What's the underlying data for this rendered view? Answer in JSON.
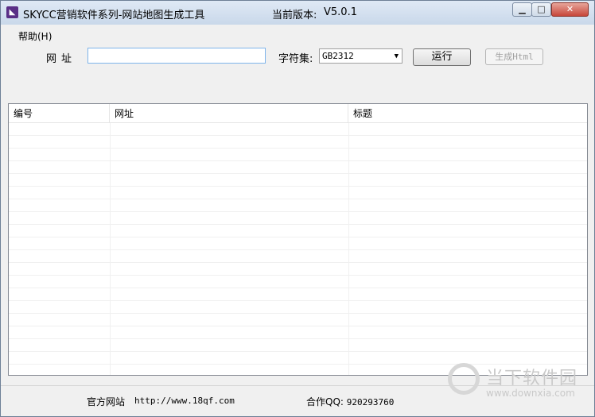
{
  "window": {
    "title": "SKYCC营销软件系列-网站地图生成工具",
    "version_label": "当前版本:",
    "version_value": "V5.0.1",
    "icon": "app-logo-icon"
  },
  "menu": {
    "help": "帮助(H)"
  },
  "form": {
    "url_label": "网址",
    "url_value": "",
    "charset_label": "字符集:",
    "charset_value": "GB2312",
    "run_button": "运行",
    "generate_button": "生成Html"
  },
  "table": {
    "columns": [
      "编号",
      "网址",
      "标题"
    ],
    "rows": []
  },
  "status": {
    "site_label": "官方网站",
    "site_url": "http://www.18qf.com",
    "qq_label": "合作QQ:",
    "qq_value": "920293760"
  },
  "watermark": {
    "text": "当下软件园",
    "url": "www.downxia.com"
  }
}
